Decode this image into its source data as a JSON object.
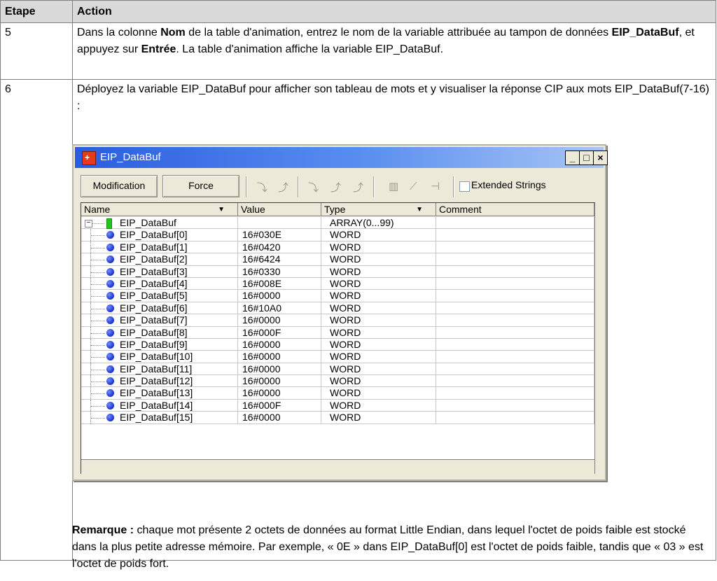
{
  "table": {
    "headers": [
      "Etape",
      "Action"
    ],
    "row5": {
      "step": "5",
      "text_parts": [
        "Dans la colonne ",
        "Nom",
        " de la table d'animation, entrez le nom de la variable attribuée au tampon de données ",
        "EIP_DataBuf",
        ", et appuyez sur ",
        "Entrée",
        ". La table d'animation affiche la variable EIP_DataBuf."
      ]
    },
    "row6": {
      "step": "6",
      "intro": "Déployez la variable EIP_DataBuf pour afficher son tableau de mots et y visualiser la réponse CIP aux mots EIP_DataBuf(7-16) :",
      "remark_label": "Remarque :",
      "remark_text": " chaque mot présente 2 octets de données au format Little Endian, dans lequel l'octet de poids faible est stocké dans la plus petite adresse mémoire. Par exemple, « 0E » dans EIP_DataBuf[0] est l'octet de poids faible, tandis que « 03 » est l'octet de poids fort."
    }
  },
  "window": {
    "title": "EIP_DataBuf",
    "buttons": {
      "minimize": "_",
      "maximize": "□",
      "close": "×"
    },
    "toolbar": {
      "modification": "Modification",
      "force": "Force",
      "extended_strings": "Extended Strings"
    },
    "columns": [
      "Name",
      "Value",
      "Type",
      "Comment"
    ],
    "root": {
      "name": "EIP_DataBuf",
      "value": "",
      "type": "ARRAY(0...99)",
      "comment": ""
    },
    "rows": [
      {
        "name": "EIP_DataBuf[0]",
        "value": "16#030E",
        "type": "WORD"
      },
      {
        "name": "EIP_DataBuf[1]",
        "value": "16#0420",
        "type": "WORD"
      },
      {
        "name": "EIP_DataBuf[2]",
        "value": "16#6424",
        "type": "WORD"
      },
      {
        "name": "EIP_DataBuf[3]",
        "value": "16#0330",
        "type": "WORD"
      },
      {
        "name": "EIP_DataBuf[4]",
        "value": "16#008E",
        "type": "WORD"
      },
      {
        "name": "EIP_DataBuf[5]",
        "value": "16#0000",
        "type": "WORD"
      },
      {
        "name": "EIP_DataBuf[6]",
        "value": "16#10A0",
        "type": "WORD"
      },
      {
        "name": "EIP_DataBuf[7]",
        "value": "16#0000",
        "type": "WORD"
      },
      {
        "name": "EIP_DataBuf[8]",
        "value": "16#000F",
        "type": "WORD"
      },
      {
        "name": "EIP_DataBuf[9]",
        "value": "16#0000",
        "type": "WORD"
      },
      {
        "name": "EIP_DataBuf[10]",
        "value": "16#0000",
        "type": "WORD"
      },
      {
        "name": "EIP_DataBuf[11]",
        "value": "16#0000",
        "type": "WORD"
      },
      {
        "name": "EIP_DataBuf[12]",
        "value": "16#0000",
        "type": "WORD"
      },
      {
        "name": "EIP_DataBuf[13]",
        "value": "16#0000",
        "type": "WORD"
      },
      {
        "name": "EIP_DataBuf[14]",
        "value": "16#000F",
        "type": "WORD"
      },
      {
        "name": "EIP_DataBuf[15]",
        "value": "16#0000",
        "type": "WORD"
      }
    ]
  }
}
